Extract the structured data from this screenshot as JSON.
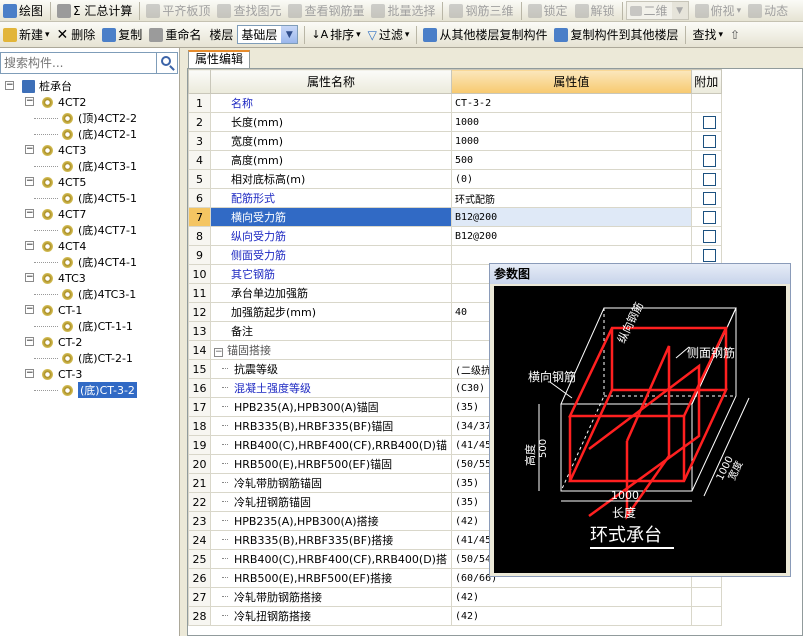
{
  "toolbar1": {
    "items": [
      {
        "label": "绘图",
        "disabled": false,
        "icon": "draw-icon"
      },
      {
        "label": "Σ 汇总计算",
        "disabled": false,
        "icon": "sum-icon"
      },
      {
        "label": "平齐板顶",
        "disabled": true,
        "icon": "align-icon"
      },
      {
        "label": "查找图元",
        "disabled": true,
        "icon": "find-icon"
      },
      {
        "label": "查看钢筋量",
        "disabled": true,
        "icon": "view-rebar-icon"
      },
      {
        "label": "批量选择",
        "disabled": true,
        "icon": "batch-select-icon"
      },
      {
        "label": "钢筋三维",
        "disabled": true,
        "icon": "rebar-3d-icon"
      },
      {
        "label": "锁定",
        "disabled": true,
        "icon": "lock-icon"
      },
      {
        "label": "解锁",
        "disabled": true,
        "icon": "unlock-icon"
      }
    ],
    "view_combo": "二维",
    "view_mode": "俯视",
    "dynamic": "动态"
  },
  "toolbar2": {
    "new_label": "新建",
    "delete_label": "删除",
    "copy_label": "复制",
    "rename_label": "重命名",
    "floor_label": "楼层",
    "floor_value": "基础层",
    "sort_label": "排序",
    "filter_label": "过滤",
    "copy_from_label": "从其他楼层复制构件",
    "copy_to_label": "复制构件到其他楼层",
    "find_label": "查找"
  },
  "search": {
    "placeholder": "搜索构件..."
  },
  "tree": {
    "root": "桩承台",
    "groups": [
      {
        "name": "4CT2",
        "children": [
          "(顶)4CT2-2",
          "(底)4CT2-1"
        ]
      },
      {
        "name": "4CT3",
        "children": [
          "(底)4CT3-1"
        ]
      },
      {
        "name": "4CT5",
        "children": [
          "(底)4CT5-1"
        ]
      },
      {
        "name": "4CT7",
        "children": [
          "(底)4CT7-1"
        ]
      },
      {
        "name": "4CT4",
        "children": [
          "(底)4CT4-1"
        ]
      },
      {
        "name": "4TC3",
        "children": [
          "(底)4TC3-1"
        ]
      },
      {
        "name": "CT-1",
        "children": [
          "(底)CT-1-1"
        ]
      },
      {
        "name": "CT-2",
        "children": [
          "(底)CT-2-1"
        ]
      },
      {
        "name": "CT-3",
        "children": [
          "(底)CT-3-2"
        ]
      }
    ]
  },
  "tab": {
    "label": "属性编辑"
  },
  "grid": {
    "headers": {
      "name": "属性名称",
      "value": "属性值",
      "extra": "附加"
    },
    "rows": [
      {
        "n": "1",
        "name": "名称",
        "value": "CT-3-2",
        "style": "blue",
        "check": false
      },
      {
        "n": "2",
        "name": "长度(mm)",
        "value": "1000",
        "style": "",
        "check": true
      },
      {
        "n": "3",
        "name": "宽度(mm)",
        "value": "1000",
        "style": "",
        "check": true
      },
      {
        "n": "4",
        "name": "高度(mm)",
        "value": "500",
        "style": "",
        "check": true
      },
      {
        "n": "5",
        "name": "相对底标高(m)",
        "value": "(0)",
        "style": "",
        "check": true
      },
      {
        "n": "6",
        "name": "配筋形式",
        "value": "环式配筋",
        "style": "blue",
        "check": true
      },
      {
        "n": "7",
        "name": "横向受力筋",
        "value": "B12@200",
        "style": "blue",
        "check": true
      },
      {
        "n": "8",
        "name": "纵向受力筋",
        "value": "B12@200",
        "style": "blue",
        "check": true
      },
      {
        "n": "9",
        "name": "侧面受力筋",
        "value": "",
        "style": "blue",
        "check": true
      },
      {
        "n": "10",
        "name": "其它钢筋",
        "value": "",
        "style": "blue",
        "check": false
      },
      {
        "n": "11",
        "name": "承台单边加强筋",
        "value": "",
        "style": "",
        "check": false
      },
      {
        "n": "12",
        "name": "加强筋起步(mm)",
        "value": "40",
        "style": "",
        "check": false
      },
      {
        "n": "13",
        "name": "备注",
        "value": "",
        "style": "",
        "check": false
      },
      {
        "n": "14",
        "name": "锚固搭接",
        "value": "",
        "style": "gray",
        "check": false,
        "group": true
      },
      {
        "n": "15",
        "name": "抗震等级",
        "value": "(二级抗",
        "style": "",
        "check": false,
        "child": true
      },
      {
        "n": "16",
        "name": "混凝土强度等级",
        "value": "(C30)",
        "style": "blue",
        "check": false,
        "child": true
      },
      {
        "n": "17",
        "name": "HPB235(A),HPB300(A)锚固",
        "value": "(35)",
        "style": "",
        "check": false,
        "child": true
      },
      {
        "n": "18",
        "name": "HRB335(B),HRBF335(BF)锚固",
        "value": "(34/37",
        "style": "",
        "check": false,
        "child": true
      },
      {
        "n": "19",
        "name": "HRB400(C),HRBF400(CF),RRB400(D)锚",
        "value": "(41/45",
        "style": "",
        "check": false,
        "child": true
      },
      {
        "n": "20",
        "name": "HRB500(E),HRBF500(EF)锚固",
        "value": "(50/55",
        "style": "",
        "check": false,
        "child": true
      },
      {
        "n": "21",
        "name": "冷轧带肋钢筋锚固",
        "value": "(35)",
        "style": "",
        "check": false,
        "child": true
      },
      {
        "n": "22",
        "name": "冷轧扭钢筋锚固",
        "value": "(35)",
        "style": "",
        "check": false,
        "child": true
      },
      {
        "n": "23",
        "name": "HPB235(A),HPB300(A)搭接",
        "value": "(42)",
        "style": "",
        "check": false,
        "child": true
      },
      {
        "n": "24",
        "name": "HRB335(B),HRBF335(BF)搭接",
        "value": "(41/45",
        "style": "",
        "check": false,
        "child": true
      },
      {
        "n": "25",
        "name": "HRB400(C),HRBF400(CF),RRB400(D)搭",
        "value": "(50/54",
        "style": "",
        "check": false,
        "child": true
      },
      {
        "n": "26",
        "name": "HRB500(E),HRBF500(EF)搭接",
        "value": "(60/66)",
        "style": "",
        "check": false,
        "child": true
      },
      {
        "n": "27",
        "name": "冷轧带肋钢筋搭接",
        "value": "(42)",
        "style": "",
        "check": false,
        "child": true
      },
      {
        "n": "28",
        "name": "冷轧扭钢筋搭接",
        "value": "(42)",
        "style": "",
        "check": false,
        "child": true
      }
    ]
  },
  "param_window": {
    "title": "参数图",
    "label_longitudinal": "纵向钢筋",
    "label_side": "侧面钢筋",
    "label_transverse": "横向钢筋",
    "label_height": "高度",
    "label_height_value": "500",
    "label_length_value": "1000",
    "label_length": "长度",
    "label_width_value": "1000",
    "label_width": "宽度",
    "caption": "环式承台"
  },
  "colors": {
    "rebar": "#ff2020",
    "selection": "#316ac5",
    "header_value": "#f7c96f",
    "label_blue": "#1d28c2"
  }
}
